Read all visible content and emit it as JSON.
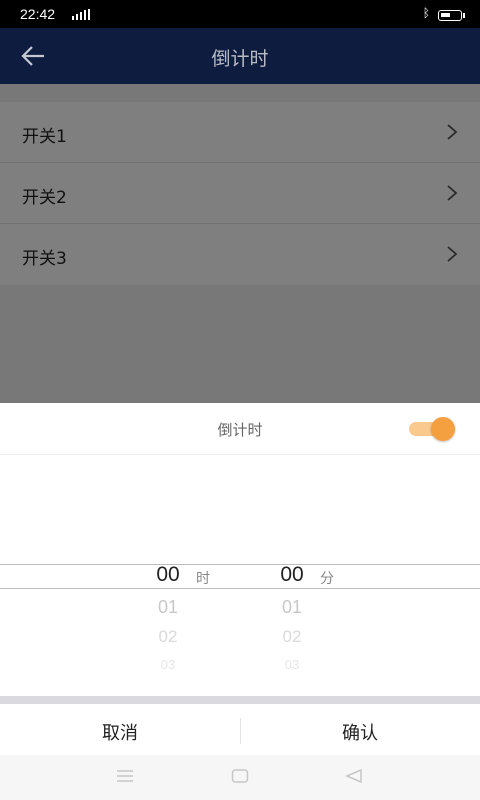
{
  "status_bar": {
    "time": "22:42",
    "bluetooth_icon": "bluetooth-icon",
    "battery_level": 0.55
  },
  "app_bar": {
    "title": "倒计时",
    "back_icon": "back-arrow-icon"
  },
  "switches": [
    {
      "label": "开关1"
    },
    {
      "label": "开关2"
    },
    {
      "label": "开关3"
    }
  ],
  "sheet": {
    "title": "倒计时",
    "toggle_on": true,
    "hours": {
      "selected": "00",
      "next": [
        "01",
        "02",
        "03"
      ],
      "unit": "时"
    },
    "minutes": {
      "selected": "00",
      "next": [
        "01",
        "02",
        "03"
      ],
      "unit": "分"
    },
    "cancel_label": "取消",
    "confirm_label": "确认"
  },
  "colors": {
    "app_bar": "#0e1d3f",
    "accent": "#f5a040"
  }
}
